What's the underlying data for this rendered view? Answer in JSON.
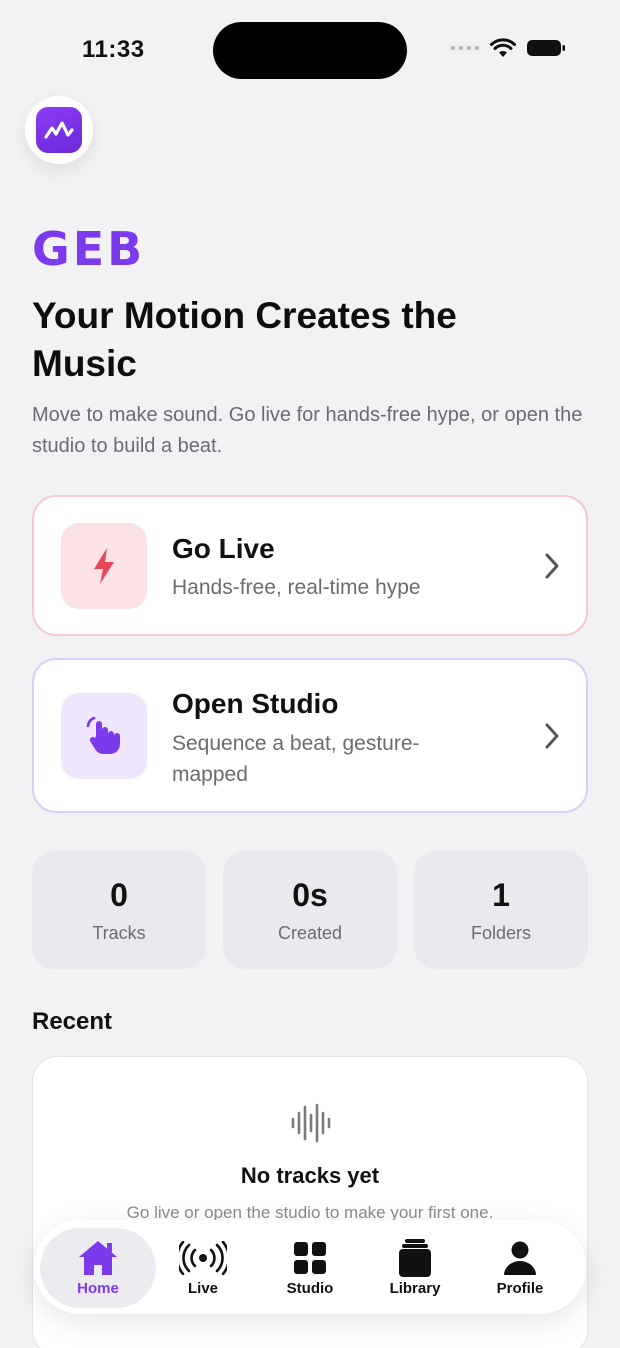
{
  "status_bar": {
    "time": "11:33"
  },
  "brand": "GEB",
  "headline": "Your Motion Creates the Music",
  "subtitle": "Move to make sound. Go live for hands-free hype, or open the studio to build a beat.",
  "actions": [
    {
      "title": "Go Live",
      "subtitle": "Hands-free, real-time hype",
      "icon": "bolt-icon",
      "accent": "#e8465c"
    },
    {
      "title": "Open Studio",
      "subtitle": "Sequence a beat, gesture-mapped",
      "icon": "hand-gesture-icon",
      "accent": "#7c3aed"
    }
  ],
  "stats": [
    {
      "value": "0",
      "label": "Tracks"
    },
    {
      "value": "0s",
      "label": "Created"
    },
    {
      "value": "1",
      "label": "Folders"
    }
  ],
  "recent": {
    "title": "Recent",
    "empty_title": "No tracks yet",
    "empty_subtitle": "Go live or open the studio to make your first one."
  },
  "tabs": [
    {
      "label": "Home",
      "icon": "home-icon",
      "active": true
    },
    {
      "label": "Live",
      "icon": "broadcast-icon",
      "active": false
    },
    {
      "label": "Studio",
      "icon": "grid-icon",
      "active": false
    },
    {
      "label": "Library",
      "icon": "library-icon",
      "active": false
    },
    {
      "label": "Profile",
      "icon": "person-icon",
      "active": false
    }
  ],
  "colors": {
    "brand": "#7c3aed",
    "live": "#e8465c",
    "background": "#f2f2f5"
  }
}
